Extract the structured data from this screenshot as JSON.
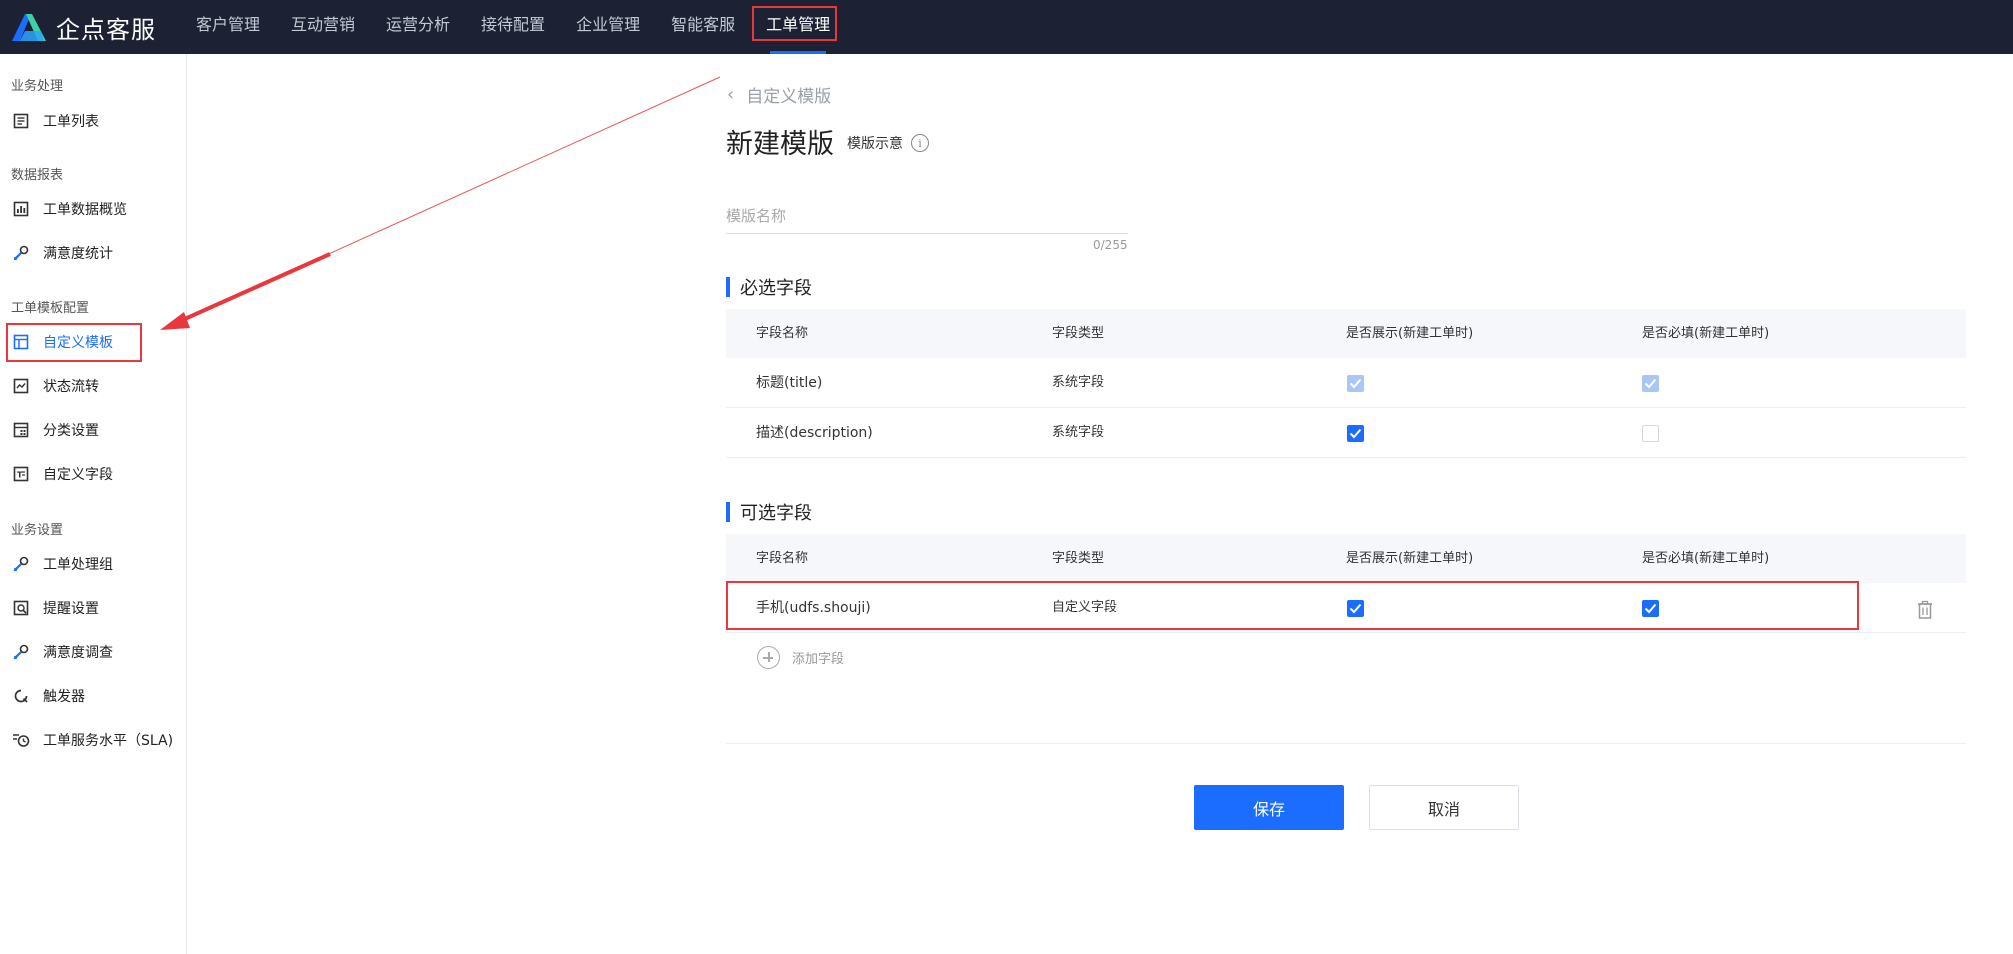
{
  "app": {
    "name": "企点客服"
  },
  "nav": {
    "items": [
      {
        "label": "客户管理"
      },
      {
        "label": "互动营销"
      },
      {
        "label": "运营分析"
      },
      {
        "label": "接待配置"
      },
      {
        "label": "企业管理"
      },
      {
        "label": "智能客服"
      },
      {
        "label": "工单管理",
        "active": true
      }
    ]
  },
  "sidebar": {
    "groups": [
      {
        "title": "业务处理",
        "items": [
          {
            "label": "工单列表",
            "icon": "list-icon"
          }
        ]
      },
      {
        "title": "数据报表",
        "items": [
          {
            "label": "工单数据概览",
            "icon": "bar-chart-icon"
          },
          {
            "label": "满意度统计",
            "icon": "wrench-icon"
          }
        ]
      },
      {
        "title": "工单模板配置",
        "items": [
          {
            "label": "自定义模板",
            "icon": "layout-icon",
            "active": true
          },
          {
            "label": "状态流转",
            "icon": "line-chart-icon"
          },
          {
            "label": "分类设置",
            "icon": "category-icon"
          },
          {
            "label": "自定义字段",
            "icon": "text-field-icon"
          }
        ]
      },
      {
        "title": "业务设置",
        "items": [
          {
            "label": "工单处理组",
            "icon": "wrench-icon"
          },
          {
            "label": "提醒设置",
            "icon": "reminder-icon"
          },
          {
            "label": "满意度调查",
            "icon": "wrench-icon"
          },
          {
            "label": "触发器",
            "icon": "trigger-icon"
          },
          {
            "label": "工单服务水平（SLA)",
            "icon": "clock-icon"
          }
        ]
      }
    ]
  },
  "main": {
    "back_label": "自定义模版",
    "title": "新建模版",
    "sample_label": "模版示意",
    "name_input": {
      "placeholder": "模版名称",
      "value": "",
      "counter": "0/255"
    },
    "required_section": {
      "title": "必选字段",
      "columns": [
        "字段名称",
        "字段类型",
        "是否展示(新建工单时)",
        "是否必填(新建工单时)"
      ],
      "rows": [
        {
          "name": "标题(title)",
          "type": "系统字段",
          "show": "checked-disabled",
          "required": "checked-disabled"
        },
        {
          "name": "描述(description)",
          "type": "系统字段",
          "show": "checked",
          "required": "unchecked"
        }
      ]
    },
    "optional_section": {
      "title": "可选字段",
      "columns": [
        "字段名称",
        "字段类型",
        "是否展示(新建工单时)",
        "是否必填(新建工单时)"
      ],
      "rows": [
        {
          "name": "手机(udfs.shouji)",
          "type": "自定义字段",
          "show": "checked",
          "required": "checked"
        }
      ],
      "add_label": "添加字段"
    },
    "save_label": "保存",
    "cancel_label": "取消"
  },
  "colors": {
    "accent": "#1a6dff",
    "topbar": "#1c2234",
    "annotation": "#e8383d"
  }
}
